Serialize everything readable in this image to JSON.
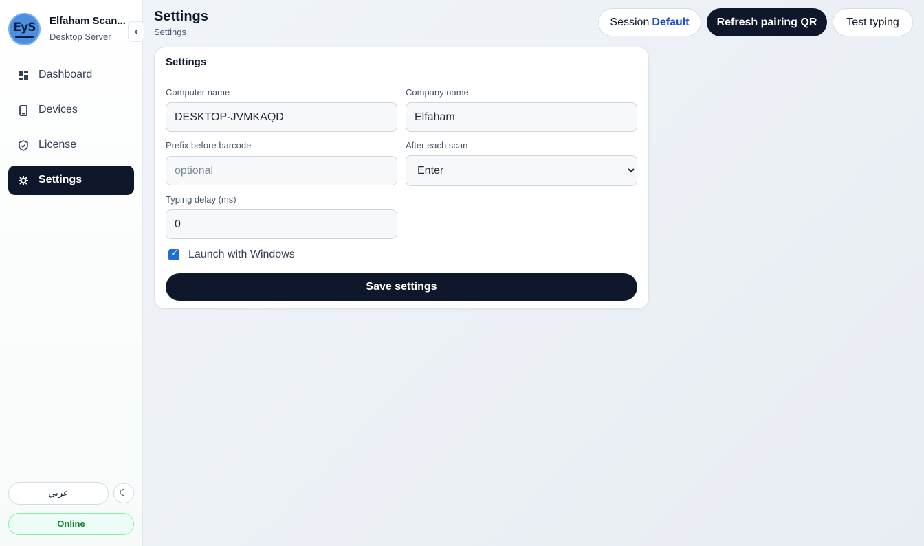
{
  "brand": {
    "logo_text": "EyS",
    "title": "Elfaham Scan...",
    "subtitle": "Desktop Server",
    "collapse_label": "‹"
  },
  "nav": {
    "items": [
      {
        "label": "Dashboard",
        "icon": "dashboard-icon"
      },
      {
        "label": "Devices",
        "icon": "phone-icon"
      },
      {
        "label": "License",
        "icon": "shield-check-icon"
      },
      {
        "label": "Settings",
        "icon": "gear-icon",
        "active": true
      }
    ]
  },
  "footer": {
    "language_label": "عربي",
    "theme_icon": "☾",
    "status": "Online"
  },
  "header": {
    "title": "Settings",
    "breadcrumb": "Settings",
    "session_label": "Session",
    "session_value": "Default",
    "refresh_label": "Refresh pairing QR",
    "test_label": "Test typing"
  },
  "settings": {
    "card_title": "Settings",
    "computer_name_label": "Computer name",
    "computer_name_value": "DESKTOP-JVMKAQD",
    "company_name_label": "Company name",
    "company_name_value": "Elfaham",
    "prefix_label": "Prefix before barcode",
    "prefix_placeholder": "optional",
    "after_scan_label": "After each scan",
    "after_scan_value": "Enter",
    "typing_delay_label": "Typing delay (ms)",
    "typing_delay_value": "0",
    "launch_label": "Launch with Windows",
    "launch_checked": true,
    "save_label": "Save settings"
  },
  "colors": {
    "primary": "#0f172a",
    "accent": "#1d4ed8",
    "online": "#15803d",
    "checkbox": "#1a6fd1"
  }
}
